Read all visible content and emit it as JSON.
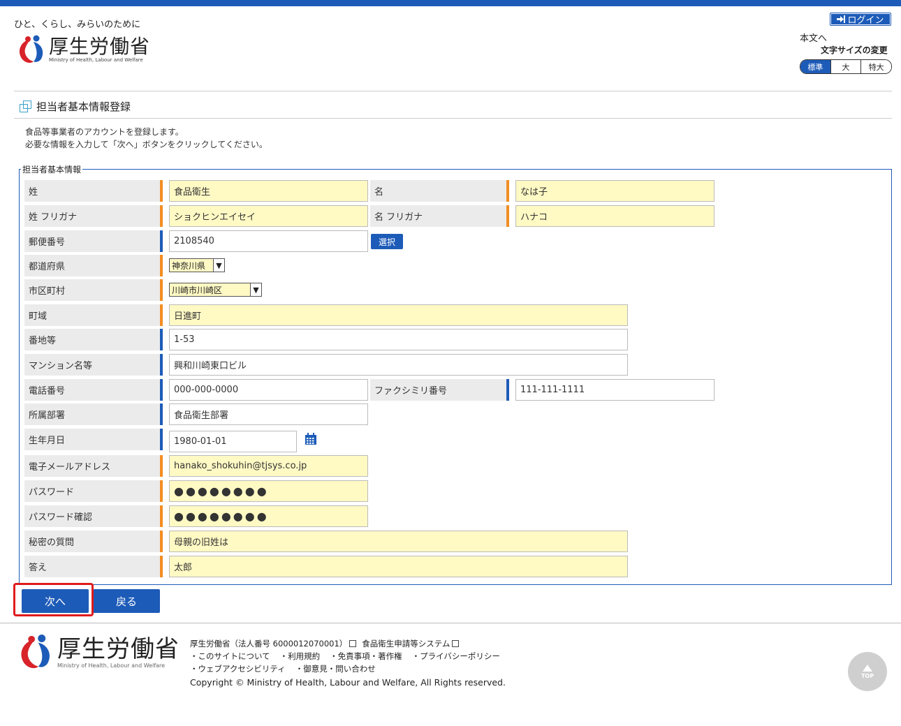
{
  "header": {
    "tagline": "ひと、くらし、みらいのために",
    "logo_name": "厚生労働省",
    "logo_sub": "Ministry of Health, Labour and Welfare",
    "login_label": "ログイン",
    "skip_link": "本文へ",
    "fontsize_label": "文字サイズの変更",
    "fontsize_options": [
      "標準",
      "大",
      "特大"
    ]
  },
  "page": {
    "title": "担当者基本情報登録",
    "desc_line1": "食品等事業者のアカウントを登録します。",
    "desc_line2": "必要な情報を入力して「次へ」ボタンをクリックしてください。",
    "legend": "担当者基本情報"
  },
  "form": {
    "last_name": {
      "label": "姓",
      "value": "食品衛生"
    },
    "first_name": {
      "label": "名",
      "value": "なは子"
    },
    "last_kana": {
      "label": "姓 フリガナ",
      "value": "ショクヒンエイセイ"
    },
    "first_kana": {
      "label": "名 フリガナ",
      "value": "ハナコ"
    },
    "postal": {
      "label": "郵便番号",
      "value": "2108540",
      "button": "選択"
    },
    "prefecture": {
      "label": "都道府県",
      "value": "神奈川県"
    },
    "city": {
      "label": "市区町村",
      "value": "川崎市川崎区"
    },
    "town": {
      "label": "町域",
      "value": "日進町"
    },
    "address": {
      "label": "番地等",
      "value": "1-53"
    },
    "building": {
      "label": "マンション名等",
      "value": "興和川崎東口ビル"
    },
    "phone": {
      "label": "電話番号",
      "value": "000-000-0000"
    },
    "fax": {
      "label": "ファクシミリ番号",
      "value": "111-111-1111"
    },
    "department": {
      "label": "所属部署",
      "value": "食品衛生部署"
    },
    "birthdate": {
      "label": "生年月日",
      "value": "1980-01-01"
    },
    "email": {
      "label": "電子メールアドレス",
      "value": "hanako_shokuhin@tjsys.co.jp"
    },
    "password": {
      "label": "パスワード",
      "value": "●●●●●●●●"
    },
    "password_confirm": {
      "label": "パスワード確認",
      "value": "●●●●●●●●"
    },
    "secret_question": {
      "label": "秘密の質問",
      "value": "母親の旧姓は"
    },
    "answer": {
      "label": "答え",
      "value": "太郎"
    }
  },
  "actions": {
    "next": "次へ",
    "back": "戻る"
  },
  "footer": {
    "org": "厚生労働省（法人番号 6000012070001）",
    "system": "食品衛生申請等システム",
    "links_row1": [
      "・このサイトについて",
      "・利用規約",
      "・免責事項・著作権",
      "・プライバシーポリシー"
    ],
    "links_row2": [
      "・ウェブアクセシビリティ",
      "・御意見・問い合わせ"
    ],
    "copyright": "Copyright © Ministry of Health, Labour and Welfare, All Rights reserved.",
    "top_label": "TOP"
  },
  "colors": {
    "primary": "#1d5bb8",
    "required_bar": "#f28d22",
    "required_bg": "#fff9c4",
    "highlight": "#e01b1b"
  }
}
